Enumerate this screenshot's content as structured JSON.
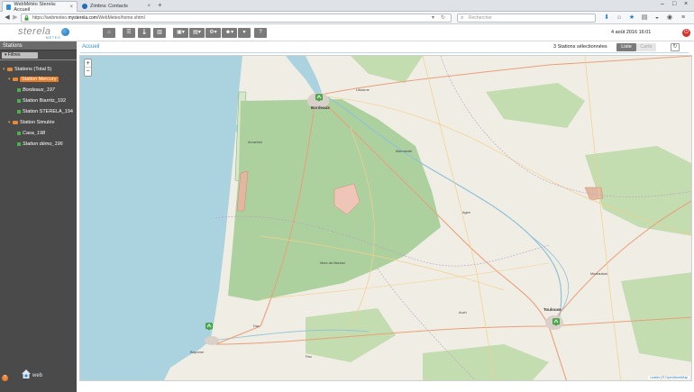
{
  "browser": {
    "tabs": [
      {
        "label": "WebMétéo Sterela: Accueil",
        "active": true
      },
      {
        "label": "Zimbra: Contacts",
        "active": false
      }
    ],
    "url_prefix": "https://webmeteo.",
    "url_host": "mysterela.com",
    "url_path": "/WebMeteo/home.xhtml",
    "search_placeholder": "Rechercher"
  },
  "app": {
    "logo_text": "sterela",
    "logo_sub": "MÉTÉO",
    "datetime": "4 août 2016 16:01"
  },
  "sidebar": {
    "title": "Stations",
    "filter_label": "Filtres",
    "root": "Stations (Total 5)",
    "groups": [
      {
        "label": "Station Mercury",
        "highlighted": true,
        "items": [
          "Bordeaux_197",
          "Station Biarritz_192",
          "Station STERELA_194"
        ],
        "italic": [
          true,
          false,
          false
        ]
      },
      {
        "label": "Station Simulée",
        "highlighted": false,
        "items": [
          "Casa_198",
          "Station démo_196"
        ],
        "italic": [
          true,
          true
        ]
      }
    ],
    "footer_logo": "web"
  },
  "main": {
    "breadcrumb": "Accueil",
    "selection_text": "3 Stations sélectionnées",
    "view_list": "Liste",
    "view_map": "Carte",
    "zoom_in": "+",
    "zoom_out": "−",
    "attribution_leaflet": "Leaflet",
    "attribution_sep": " | © ",
    "attribution_osm": "OpenStreetMap"
  },
  "map_places": [
    {
      "name": "Bordeaux",
      "cls": "city"
    },
    {
      "name": "Mont-de-Marsan",
      "cls": ""
    },
    {
      "name": "Toulouse",
      "cls": "city"
    },
    {
      "name": "Bayonne",
      "cls": ""
    },
    {
      "name": "Agen",
      "cls": ""
    },
    {
      "name": "Arcachon",
      "cls": ""
    },
    {
      "name": "Pau",
      "cls": ""
    },
    {
      "name": "Auch",
      "cls": ""
    },
    {
      "name": "Montauban",
      "cls": ""
    },
    {
      "name": "Libourne",
      "cls": ""
    },
    {
      "name": "Marmande",
      "cls": ""
    },
    {
      "name": "Dax",
      "cls": ""
    }
  ],
  "colors": {
    "accent": "#e87b26",
    "sidebar": "#4a4a4a",
    "sea": "#aad3df",
    "forest": "#add19e",
    "land": "#f2efe9",
    "station_marker": "#49b34a"
  }
}
